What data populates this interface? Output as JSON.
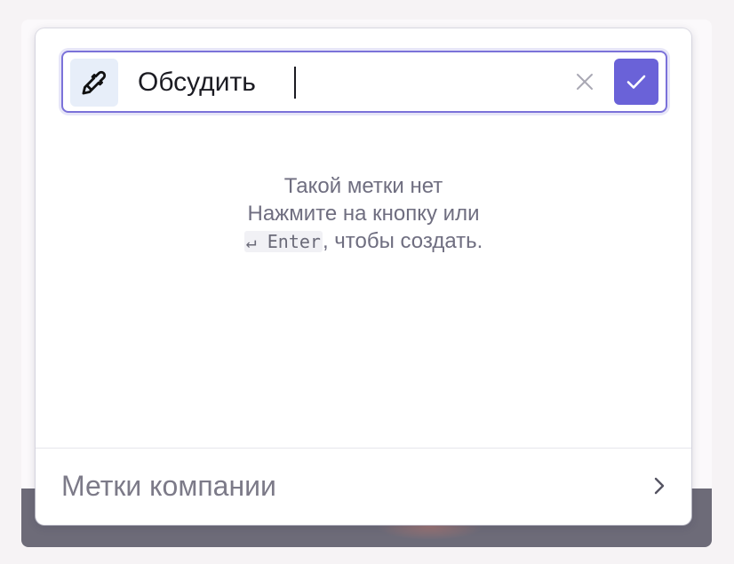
{
  "popup": {
    "search": {
      "value": "Обсудить",
      "placeholder": ""
    },
    "empty_state": {
      "line1": "Такой метки нет",
      "line2": "Нажмите на кнопку или",
      "key_hint": "↵ Enter",
      "line3_suffix": ", чтобы создать."
    },
    "footer": {
      "company_tags_label": "Метки компании"
    }
  },
  "icons": {
    "picker": "eyedropper-icon",
    "clear": "close-icon",
    "confirm": "check-icon",
    "footer": "chevron-right-icon"
  },
  "colors": {
    "accent": "#6a62d8",
    "focus_border": "#7b72d9",
    "picker_bg": "#e7eef9",
    "muted_text": "#6f6e80"
  }
}
